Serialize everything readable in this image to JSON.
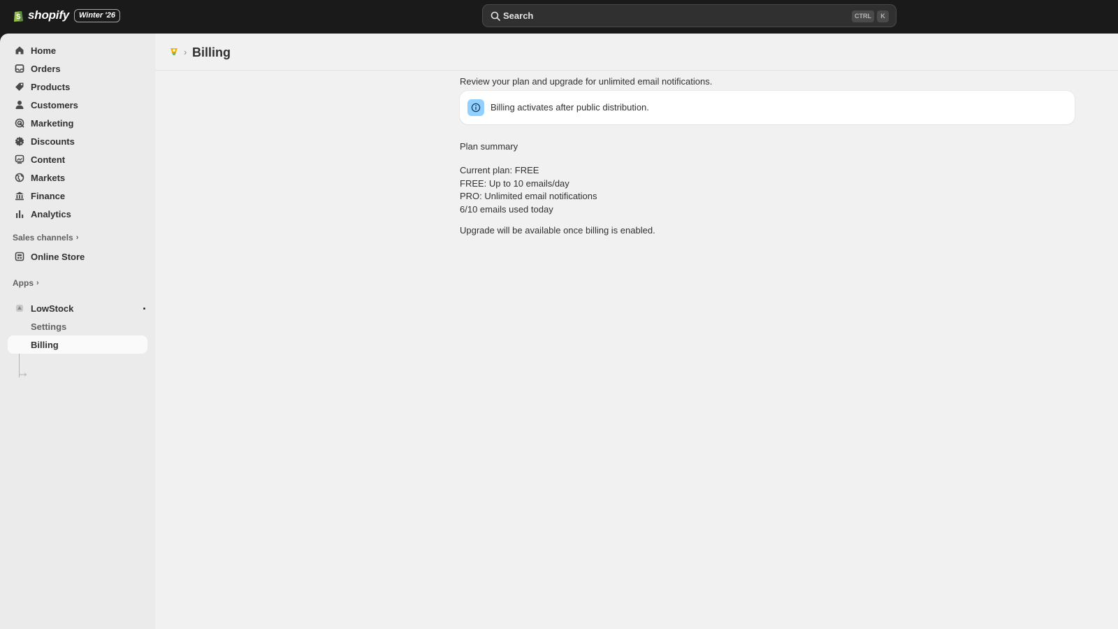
{
  "topbar": {
    "brand": "shopify",
    "edition_badge": "Winter '26",
    "search_placeholder": "Search",
    "shortcut_modifier": "CTRL",
    "shortcut_key": "K"
  },
  "sidebar": {
    "nav": [
      {
        "label": "Home",
        "icon": "home-icon"
      },
      {
        "label": "Orders",
        "icon": "inbox-icon"
      },
      {
        "label": "Products",
        "icon": "tag-icon"
      },
      {
        "label": "Customers",
        "icon": "person-icon"
      },
      {
        "label": "Marketing",
        "icon": "target-icon"
      },
      {
        "label": "Discounts",
        "icon": "discount-icon"
      },
      {
        "label": "Content",
        "icon": "image-icon"
      },
      {
        "label": "Markets",
        "icon": "globe-icon"
      },
      {
        "label": "Finance",
        "icon": "bank-icon"
      },
      {
        "label": "Analytics",
        "icon": "bar-chart-icon"
      }
    ],
    "sales_channels_label": "Sales channels",
    "online_store_label": "Online Store",
    "apps_label": "Apps",
    "app_name": "LowStock",
    "app_sub_items": [
      "Settings",
      "Billing"
    ]
  },
  "page": {
    "title": "Billing",
    "intro": "Review your plan and upgrade for unlimited email notifications.",
    "banner": "Billing activates after public distribution.",
    "plan_summary_title": "Plan summary",
    "plan_lines": [
      "Current plan: FREE",
      "FREE: Up to 10 emails/day",
      "PRO: Unlimited email notifications",
      "6/10 emails used today"
    ],
    "upgrade_note": "Upgrade will be available once billing is enabled."
  },
  "colors": {
    "topbar_bg": "#1a1a1a",
    "sidebar_bg": "#ebebeb",
    "main_bg": "#f1f1f1",
    "info_accent": "#91d0ff",
    "text": "#303030"
  }
}
